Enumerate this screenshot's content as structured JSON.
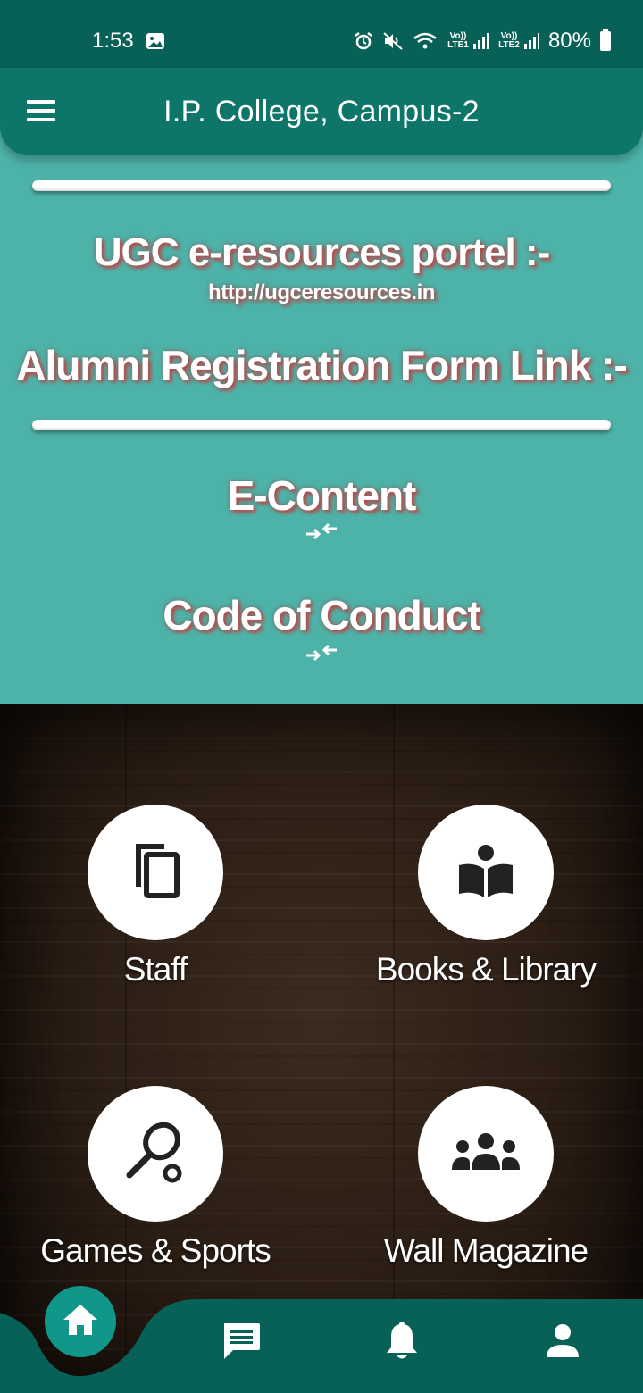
{
  "status_bar": {
    "time": "1:53",
    "sim1_label": "Vo)) LTE1",
    "sim2_label": "Vo)) LTE2",
    "battery": "80%",
    "icons": [
      "gallery-icon",
      "alarm-icon",
      "mute-icon",
      "wifi-icon",
      "signal-icon",
      "battery-icon"
    ]
  },
  "header": {
    "title": "I.P. College, Campus-2",
    "menu_icon": "menu-icon"
  },
  "content": {
    "ugc_heading": "UGC e-resources portel :-",
    "ugc_link": "http://ugceresources.in",
    "alumni_heading": "Alumni Registration Form Link :-",
    "econtent_heading": "E-Content",
    "code_heading": "Code of Conduct"
  },
  "tiles": [
    {
      "label": "Staff",
      "icon": "copy-icon"
    },
    {
      "label": "Books & Library",
      "icon": "reader-book-icon"
    },
    {
      "label": "Games & Sports",
      "icon": "racket-icon"
    },
    {
      "label": "Wall Magazine",
      "icon": "group-icon"
    }
  ],
  "bottom_nav": {
    "items": [
      "home-icon",
      "chat-icon",
      "bell-icon",
      "person-icon"
    ]
  },
  "colors": {
    "status_bar": "#086156",
    "header": "#0e7569",
    "teal_background": "#4db3a9",
    "home_fab": "#11978a",
    "text_shadow": "#b94a4a"
  }
}
